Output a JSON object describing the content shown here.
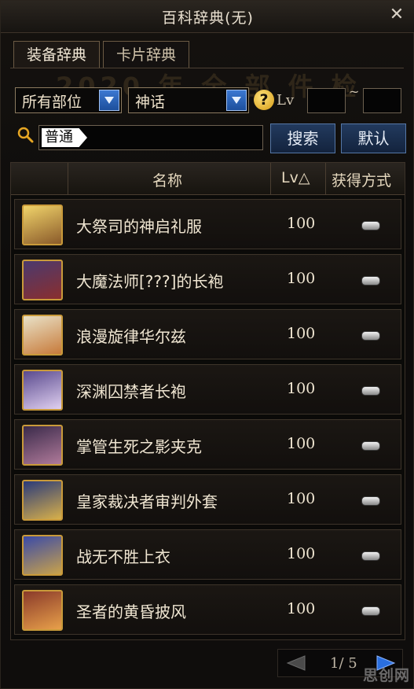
{
  "window": {
    "title": "百科辞典(无)",
    "close_glyph": "✕"
  },
  "tabs": [
    {
      "label": "装备辞典",
      "active": true
    },
    {
      "label": "卡片辞典",
      "active": false
    }
  ],
  "background_text": "2020 年 全 部 件 检",
  "filters": {
    "part_select": "所有部位",
    "rarity_select": "神话",
    "help_glyph": "?",
    "lv_label": "Lv",
    "lv_min": "",
    "lv_max": "",
    "lv_sep": "~"
  },
  "search": {
    "tag": "普通",
    "query": "",
    "search_button": "搜索",
    "default_button": "默认"
  },
  "table": {
    "headers": {
      "name": "名称",
      "lv": "Lv△",
      "obtain": "获得方式"
    },
    "rows": [
      {
        "name": "大祭司的神启礼服",
        "lv": "100"
      },
      {
        "name": "大魔法师[???]的长袍",
        "lv": "100"
      },
      {
        "name": "浪漫旋律华尔兹",
        "lv": "100"
      },
      {
        "name": "深渊囚禁者长袍",
        "lv": "100"
      },
      {
        "name": "掌管生死之影夹克",
        "lv": "100"
      },
      {
        "name": "皇家裁决者审判外套",
        "lv": "100"
      },
      {
        "name": "战无不胜上衣",
        "lv": "100"
      },
      {
        "name": "圣者的黄昏披风",
        "lv": "100"
      }
    ]
  },
  "pager": {
    "text": "1/ 5"
  },
  "watermark": "思创网",
  "colors": {
    "accent_blue": "#2a5fb8",
    "icon_border": "#c99a3a",
    "text": "#f0e6d2"
  }
}
